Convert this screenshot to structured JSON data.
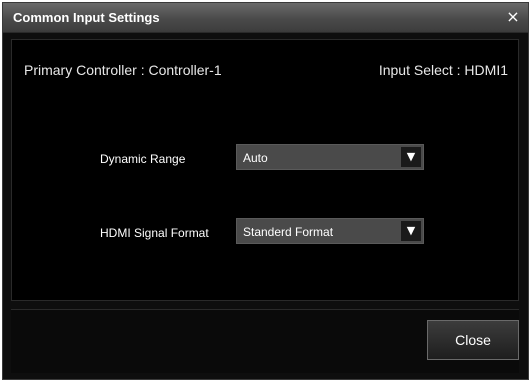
{
  "window": {
    "title": "Common Input Settings",
    "close_glyph": "×"
  },
  "info": {
    "primary_controller": "Primary Controller : Controller-1",
    "input_select": "Input Select : HDMI1"
  },
  "fields": {
    "dynamic_range": {
      "label": "Dynamic Range",
      "value": "Auto"
    },
    "hdmi_signal_format": {
      "label": "HDMI Signal Format",
      "value": "Standerd Format"
    },
    "dropdown_arrow": "▼"
  },
  "footer": {
    "close_label": "Close"
  },
  "icons": {
    "window_close": "close-icon",
    "dropdown": "chevron-down-icon"
  },
  "colors": {
    "dialog_bg": "#0e0e0e",
    "titlebar": "#4a4a4a",
    "select_bg": "#4a4a4a",
    "text": "#ffffff"
  }
}
